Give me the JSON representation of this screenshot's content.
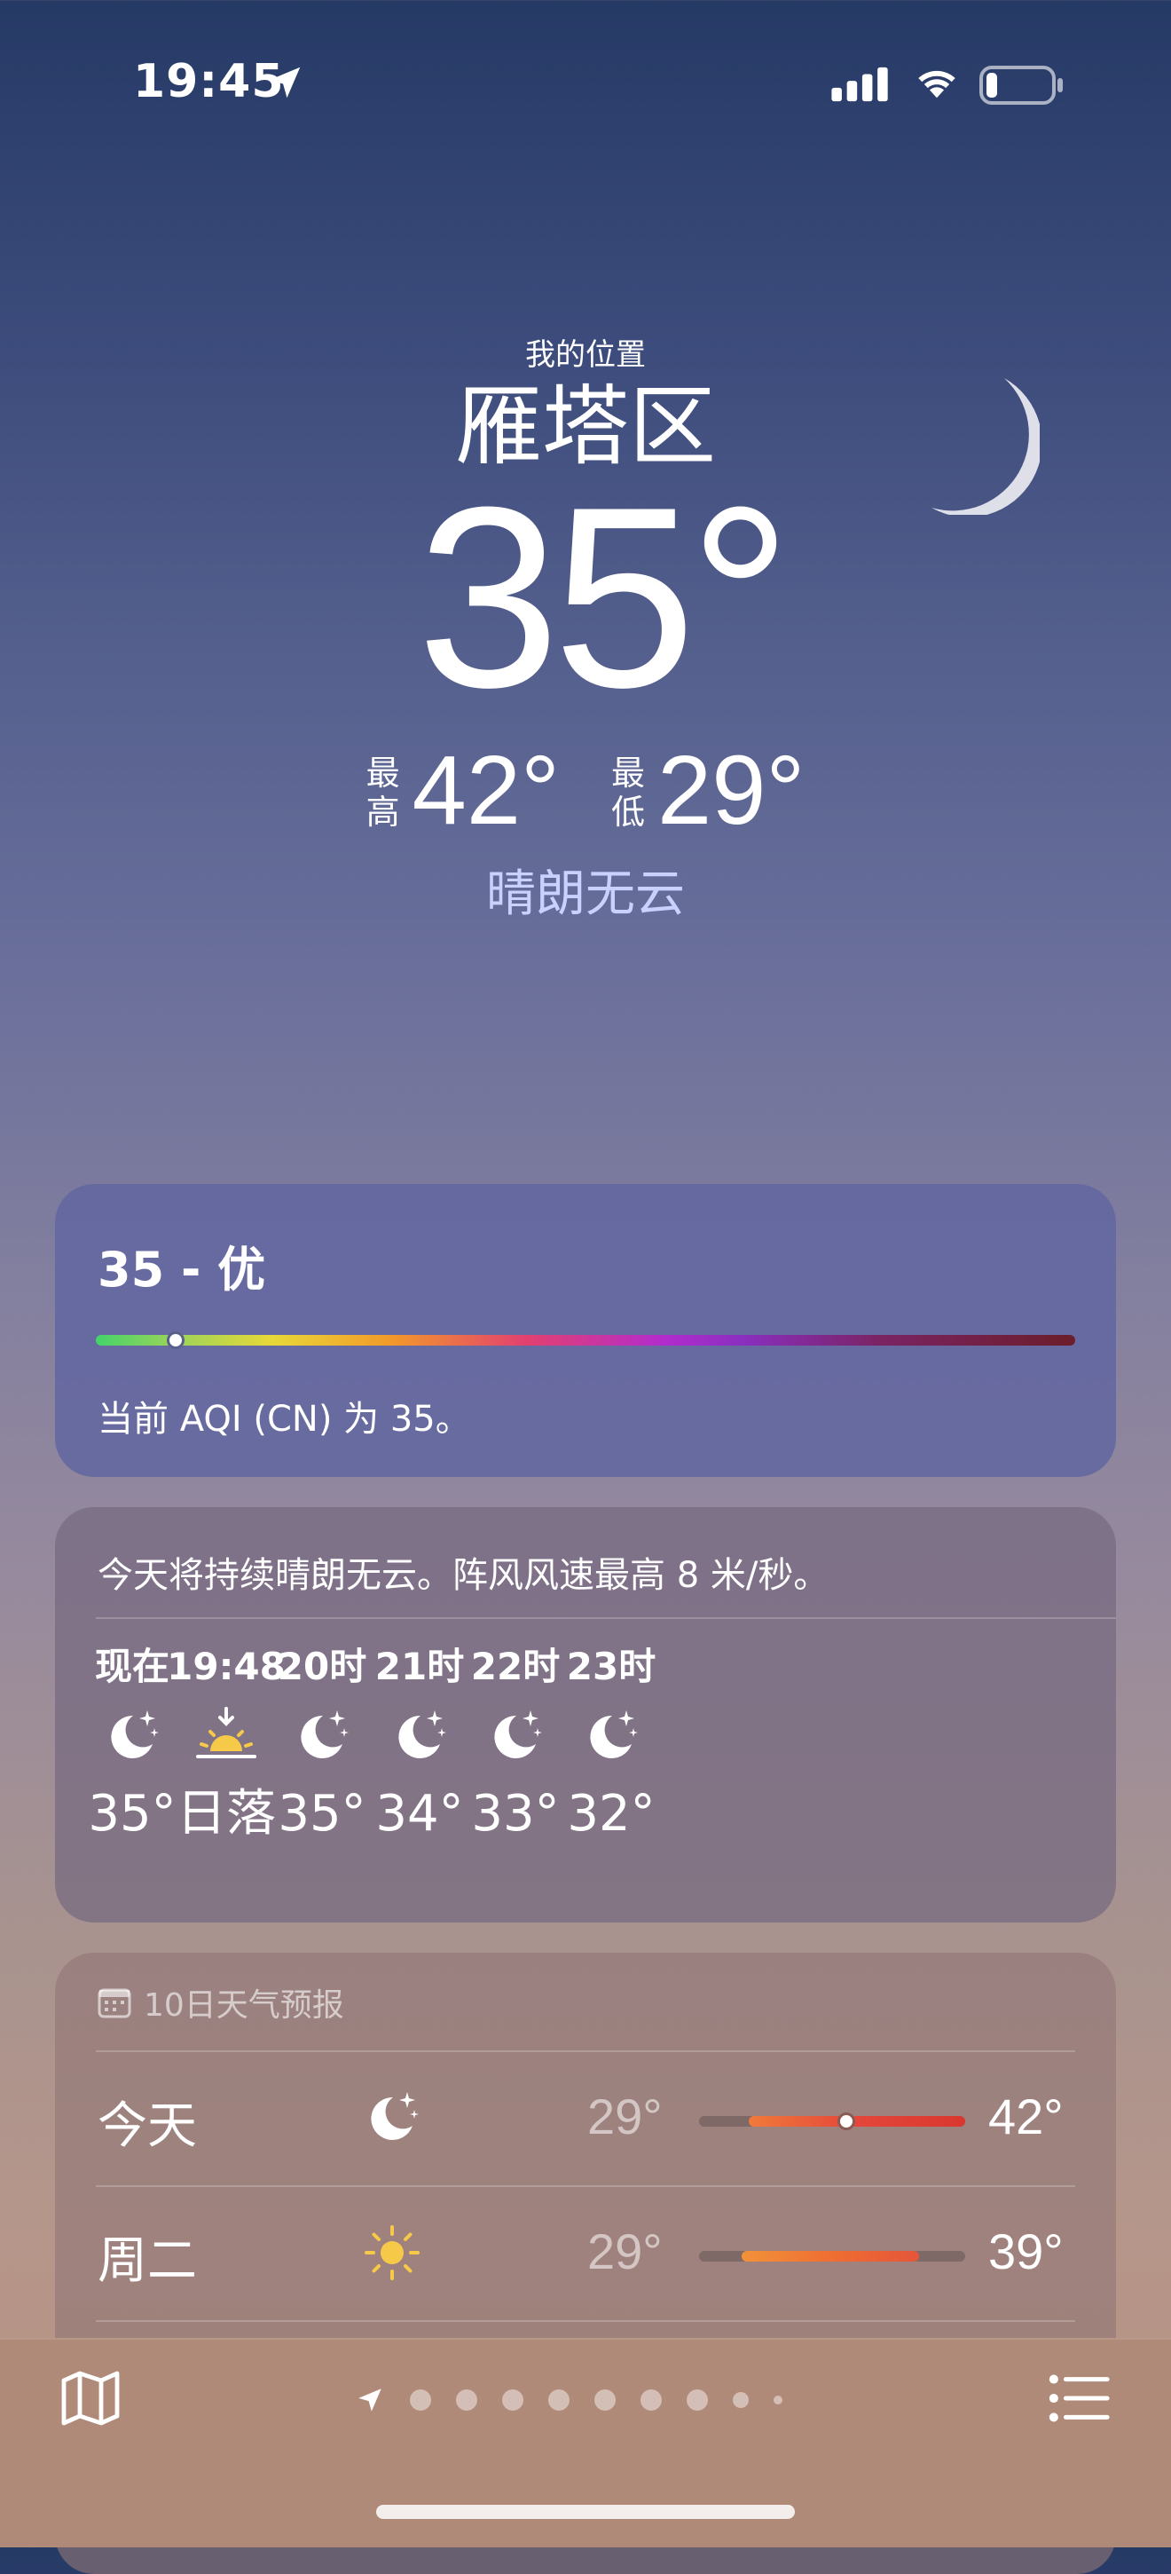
{
  "status_bar": {
    "time": "19:45",
    "icons": [
      "location-arrow-icon",
      "cellular-signal-icon",
      "wifi-icon",
      "battery-icon"
    ]
  },
  "header": {
    "subtitle": "我的位置",
    "city": "雁塔区",
    "temperature": "35°",
    "high_label": "最高",
    "high": "42°",
    "low_label": "最低",
    "low": "29°",
    "condition": "晴朗无云",
    "condition_color": "#c9d2ff"
  },
  "aqi": {
    "value": "35 - 优",
    "level": 35,
    "description": "当前 AQI (CN) 为 35。"
  },
  "hourly": {
    "summary": "今天将持续晴朗无云。阵风风速最高 8 米/秒。",
    "items": [
      {
        "time": "现在",
        "icon": "moon-stars-icon",
        "value": "35°"
      },
      {
        "time": "19:48",
        "icon": "sunset-icon",
        "value": "日落"
      },
      {
        "time": "20时",
        "icon": "moon-stars-icon",
        "value": "35°"
      },
      {
        "time": "21时",
        "icon": "moon-stars-icon",
        "value": "34°"
      },
      {
        "time": "22时",
        "icon": "moon-stars-icon",
        "value": "33°"
      },
      {
        "time": "23时",
        "icon": "moon-stars-icon",
        "value": "32°"
      }
    ]
  },
  "ten_day": {
    "header": "10日天气预报",
    "header_icon": "calendar-icon",
    "days": [
      {
        "day": "今天",
        "icon": "moon-stars-icon",
        "low": "29°",
        "high": "42°",
        "has_current": true
      },
      {
        "day": "周二",
        "icon": "sun-icon",
        "low": "29°",
        "high": "39°",
        "has_current": false
      }
    ]
  },
  "toolbar": {
    "left_icon": "map-icon",
    "right_icon": "list-icon",
    "page_dots": 9,
    "current_page": 0
  }
}
